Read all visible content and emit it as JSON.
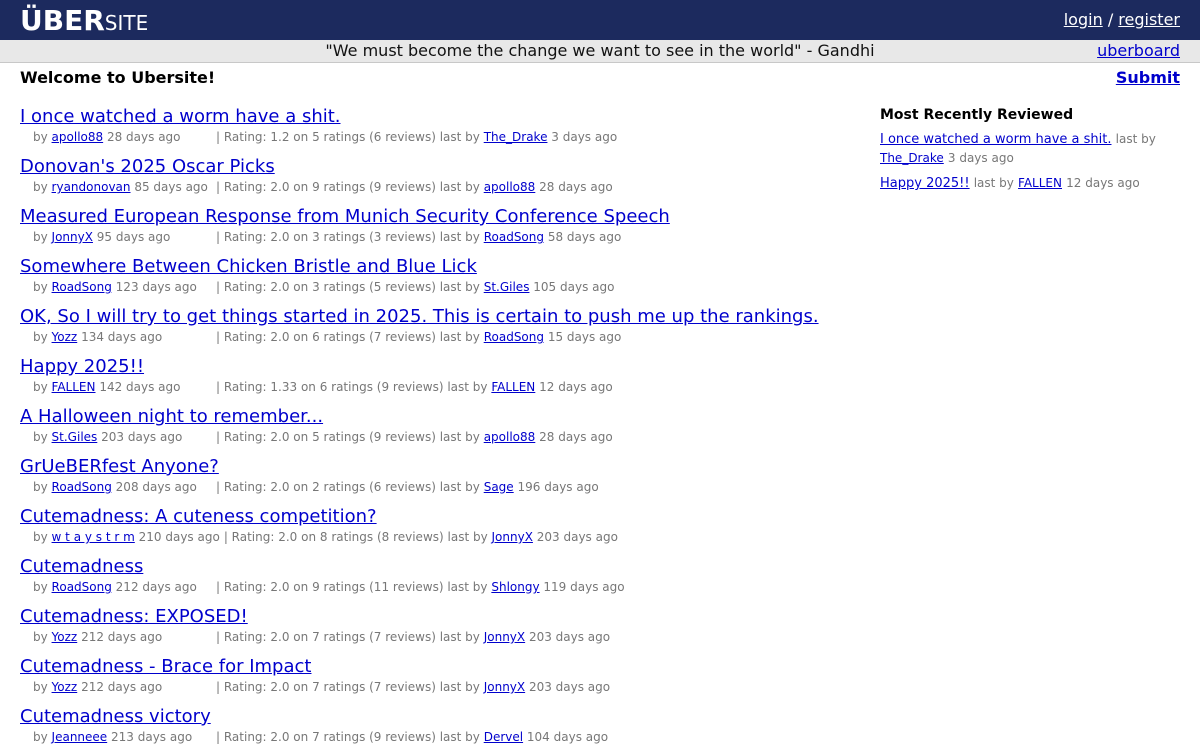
{
  "header": {
    "logo_big": "ÜBER",
    "logo_small": "SITE",
    "login_label": "login",
    "separator": "/",
    "register_label": "register"
  },
  "quotebar": {
    "quote": "\"We must become the change we want to see in the world\" - Gandhi",
    "uberboard_label": "uberboard"
  },
  "main": {
    "welcome": "Welcome to Ubersite!",
    "submit_label": "Submit"
  },
  "stories": [
    {
      "title": "I once watched a worm have a shit.",
      "author": "apollo88",
      "age": "28 days ago",
      "rating": "| Rating: 1.2 on 5 ratings (6 reviews) last by",
      "last_by": "The_Drake",
      "last_age": "3 days ago"
    },
    {
      "title": "Donovan's 2025 Oscar Picks",
      "author": "ryandonovan",
      "age": "85 days ago",
      "rating": "| Rating: 2.0 on 9 ratings (9 reviews) last by",
      "last_by": "apollo88",
      "last_age": "28 days ago"
    },
    {
      "title": "Measured European Response from Munich Security Conference Speech",
      "author": "JonnyX",
      "age": "95 days ago",
      "rating": "| Rating: 2.0 on 3 ratings (3 reviews) last by",
      "last_by": "RoadSong",
      "last_age": "58 days ago"
    },
    {
      "title": "Somewhere Between Chicken Bristle and Blue Lick",
      "author": "RoadSong",
      "age": "123 days ago",
      "rating": "| Rating: 2.0 on 3 ratings (5 reviews) last by",
      "last_by": "St.Giles",
      "last_age": "105 days ago"
    },
    {
      "title": "OK, So I will try to get things started in 2025. This is certain to push me up the rankings.",
      "author": "Yozz",
      "age": "134 days ago",
      "rating": "| Rating: 2.0 on 6 ratings (7 reviews) last by",
      "last_by": "RoadSong",
      "last_age": "15 days ago"
    },
    {
      "title": "Happy 2025!!",
      "author": "FALLEN",
      "age": "142 days ago",
      "rating": "| Rating: 1.33 on 6 ratings (9 reviews) last by",
      "last_by": "FALLEN",
      "last_age": "12 days ago"
    },
    {
      "title": "A Halloween night to remember...",
      "author": "St.Giles",
      "age": "203 days ago",
      "rating": "| Rating: 2.0 on 5 ratings (9 reviews) last by",
      "last_by": "apollo88",
      "last_age": "28 days ago"
    },
    {
      "title": "GrUeBERfest Anyone?",
      "author": "RoadSong",
      "age": "208 days ago",
      "rating": "| Rating: 2.0 on 2 ratings (6 reviews) last by",
      "last_by": "Sage",
      "last_age": "196 days ago"
    },
    {
      "title": "Cutemadness: A cuteness competition?",
      "author": "w t a y s t r m",
      "age": "210 days ago",
      "rating": "| Rating: 2.0 on 8 ratings (8 reviews) last by",
      "last_by": "JonnyX",
      "last_age": "203 days ago"
    },
    {
      "title": "Cutemadness",
      "author": "RoadSong",
      "age": "212 days ago",
      "rating": "| Rating: 2.0 on 9 ratings (11 reviews) last by",
      "last_by": "Shlongy",
      "last_age": "119 days ago"
    },
    {
      "title": "Cutemadness: EXPOSED!",
      "author": "Yozz",
      "age": "212 days ago",
      "rating": "| Rating: 2.0 on 7 ratings (7 reviews) last by",
      "last_by": "JonnyX",
      "last_age": "203 days ago"
    },
    {
      "title": "Cutemadness - Brace for Impact",
      "author": "Yozz",
      "age": "212 days ago",
      "rating": "| Rating: 2.0 on 7 ratings (7 reviews) last by",
      "last_by": "JonnyX",
      "last_age": "203 days ago"
    },
    {
      "title": "Cutemadness victory",
      "author": "Jeanneee",
      "age": "213 days ago",
      "rating": "| Rating: 2.0 on 7 ratings (9 reviews) last by",
      "last_by": "Dervel",
      "last_age": "104 days ago"
    }
  ],
  "sidebar": {
    "heading": "Most Recently Reviewed",
    "items": [
      {
        "title": "I once watched a worm have a shit.",
        "last_by_label": "last by",
        "last_by": "The_Drake",
        "age": "3 days ago"
      },
      {
        "title": "Happy 2025!!",
        "last_by_label": "last by",
        "last_by": "FALLEN",
        "age": "12 days ago"
      }
    ]
  },
  "colors": {
    "header_bg": "#1c2a5e",
    "quotebar_bg": "#e8e8e8",
    "link": "#0000cc",
    "meta_text": "#777777"
  }
}
